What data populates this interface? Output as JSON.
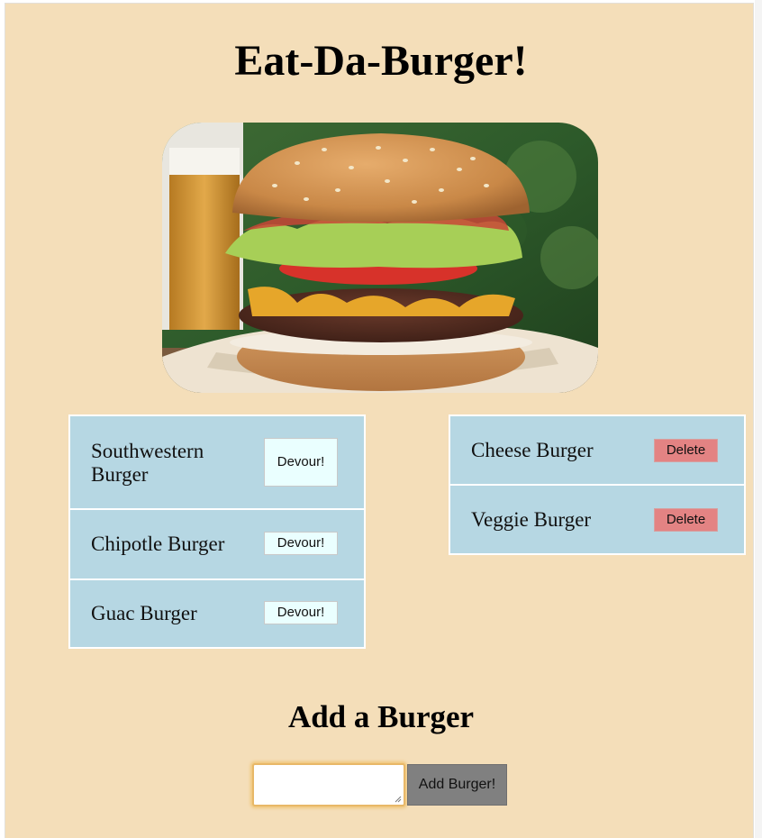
{
  "header": {
    "title": "Eat-Da-Burger!"
  },
  "hero_image": {
    "subject": "burger-photo"
  },
  "uneaten_burgers": [
    {
      "name": "Southwestern Burger",
      "button_label": "Devour!"
    },
    {
      "name": "Chipotle Burger",
      "button_label": "Devour!"
    },
    {
      "name": "Guac Burger",
      "button_label": "Devour!"
    }
  ],
  "devoured_burgers": [
    {
      "name": "Cheese Burger",
      "button_label": "Delete"
    },
    {
      "name": "Veggie Burger",
      "button_label": "Delete"
    }
  ],
  "add_form": {
    "title": "Add a Burger",
    "input_value": "",
    "submit_label": "Add Burger!"
  },
  "colors": {
    "page_background": "#f4deb9",
    "list_item_background": "#b6d7e3",
    "devour_button": "#eaffff",
    "delete_button": "#e38383",
    "add_button": "#808080",
    "input_focus": "#e8b868"
  }
}
